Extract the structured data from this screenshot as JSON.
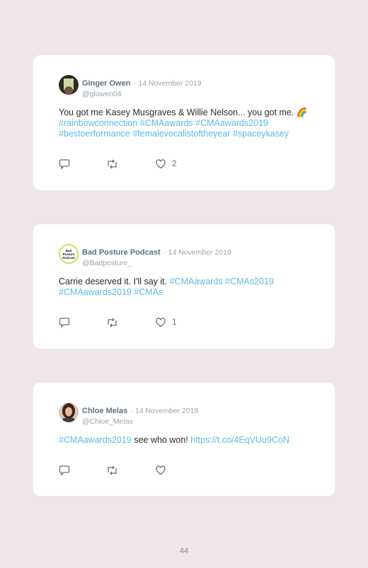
{
  "tweets": [
    {
      "name": "Ginger Owen",
      "date": "· 14 November 2019",
      "handle": "@glowen04",
      "text_plain": "You got me Kasey Musgraves & Willie Nelson... you got me.",
      "emoji": "🌈",
      "hashtags": "#rainbowconnection #CMAawards #CMAawards2019 #bestoerformance #femalevocalistoftheyear #spaceykasey",
      "likes": "2"
    },
    {
      "name": "Bad Posture Podcast",
      "date": "· 14 November 2019",
      "handle": "@Badposture_",
      "text_plain": "Carrie deserved it. I'll say it.",
      "hashtags": "#CMAawards #CMAs2019 #CMAawards2019 #CMAs",
      "likes": "1",
      "avatar_text": "Bad Posture Podcast"
    },
    {
      "name": "Chloe Melas",
      "date": "· 14 November 2019",
      "handle": "@Chloe_Melas",
      "hashtag_lead": "#CMAawards2019",
      "text_plain": "see who won!",
      "link": "https://t.co/4EqVUu9CoN",
      "likes": ""
    }
  ],
  "page_number": "44"
}
